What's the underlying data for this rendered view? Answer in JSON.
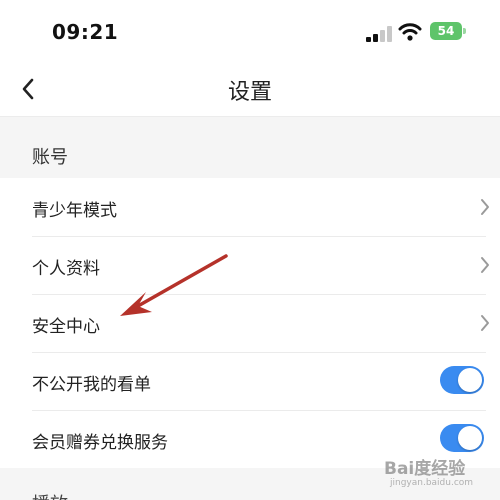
{
  "status_bar": {
    "time": "09:21",
    "battery_level": "54",
    "battery_color": "#5ec46a",
    "icons": [
      "signal-icon",
      "wifi-icon",
      "battery-icon"
    ]
  },
  "nav": {
    "title": "设置",
    "back_icon": "chevron-left-icon"
  },
  "section_account": {
    "title": "账号",
    "items": [
      {
        "label": "青少年模式",
        "control": "chevron"
      },
      {
        "label": "个人资料",
        "control": "chevron"
      },
      {
        "label": "安全中心",
        "control": "chevron"
      },
      {
        "label": "不公开我的看单",
        "control": "toggle",
        "on": true
      },
      {
        "label": "会员赠券兑换服务",
        "control": "toggle",
        "on": true
      }
    ]
  },
  "section_next": {
    "title": "播放"
  },
  "colors": {
    "toggle_on": "#3a8bf0",
    "annotation_arrow": "#b5322a"
  },
  "watermark": {
    "text": "Bai度经验",
    "sub": "jingyan.baidu.com"
  }
}
